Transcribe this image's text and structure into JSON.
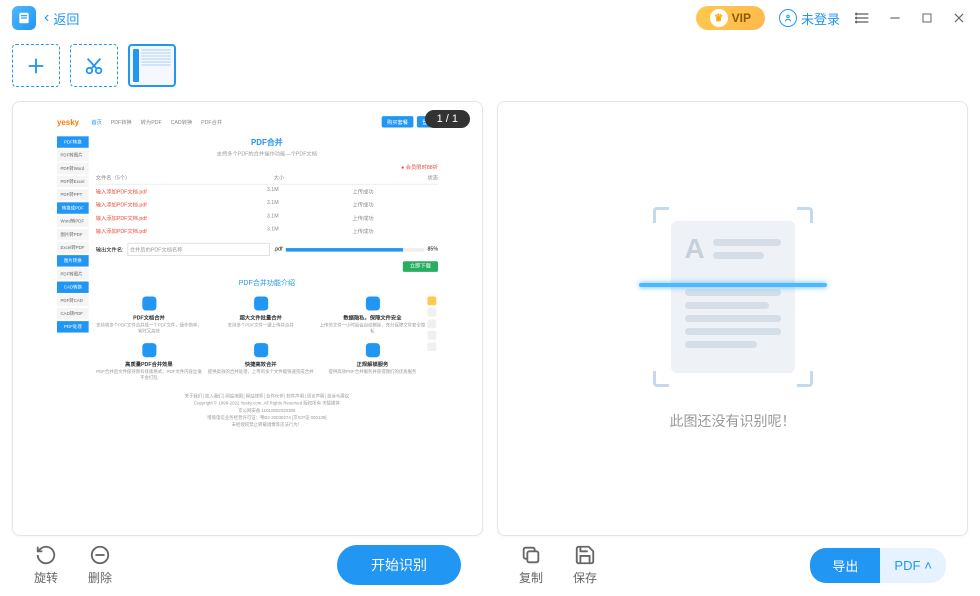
{
  "titlebar": {
    "back_label": "返回",
    "vip_label": "VIP",
    "login_label": "未登录"
  },
  "page_indicator": "1 / 1",
  "preview": {
    "logo": "yesky",
    "nav": [
      "首页",
      "PDF转换",
      "转为PDF",
      "CAD转换",
      "PDF合并"
    ],
    "header_btns": [
      "购买套餐",
      "登录"
    ],
    "title": "PDF合并",
    "subtitle": "支持多个PDF的合并操作功能—个PDF文档",
    "promo": "会员限时88折",
    "sidebar": {
      "groups": [
        {
          "title": "PDF转换",
          "items": [
            "PDF转图片",
            "PDF转Word",
            "PDF转Excel",
            "PDF转PPT"
          ]
        },
        {
          "title": "转换成PDF",
          "items": [
            "Word转PDF",
            "图片转PDF",
            "Excel转PDF"
          ]
        },
        {
          "title": "图片转换",
          "items": [
            "PDF转图片"
          ]
        },
        {
          "title": "CAD转换",
          "items": [
            "PDF转CAD",
            "CAD转PDF"
          ]
        },
        {
          "title": "PDF处理",
          "items": []
        }
      ]
    },
    "table": {
      "headers": [
        "文件名（5个）",
        "大小",
        "状态"
      ],
      "rows": [
        {
          "name": "输入添加PDF文档.pdf",
          "size": "3.1M",
          "status": "上传成功"
        },
        {
          "name": "输入添加PDF文档.pdf",
          "size": "3.1M",
          "status": "上传成功"
        },
        {
          "name": "输入添加PDF文档.pdf",
          "size": "3.1M",
          "status": "上传成功"
        },
        {
          "name": "输入添加PDF文档.pdf",
          "size": "3.1M",
          "status": "上传成功"
        }
      ]
    },
    "save_label": "输出文件名:",
    "save_value": "合并后的PDF文档名称",
    "save_ext": ".pdf",
    "progress": "85%",
    "download_btn": "立即下载",
    "features_title": "PDF合并功能介绍",
    "features": [
      {
        "title": "PDF文档合并",
        "desc": "支持将多个PDF文件合并成一个PDF文件，操作简单，省时又高效"
      },
      {
        "title": "超大文件批量合并",
        "desc": "支持多个PDF文件一键上传并合并"
      },
      {
        "title": "数据隐私，保障文件安全",
        "desc": "上传的文件一小时后会自动删除，充分保障文件安全隐私"
      },
      {
        "title": "高质量PDF合并效果",
        "desc": "PDF合并后文件保持原有排版格式，PDF文件内容丝毫不会打乱"
      },
      {
        "title": "快捷高效合并",
        "desc": "提供高效的合并处理，上传的多个文件能快速完成合并"
      },
      {
        "title": "正规解锁服务",
        "desc": "提供高效PDF合并服务并获得我们的优质服务"
      }
    ],
    "footer": {
      "links": "关于我们│加入我们│网站地图│网站律师│合作伙伴│软件声明│语言声明│投诉与建议",
      "copyright": "Copyright © 1999-2022 Yesky.com, All Rights Reserved 版权所有 天极媒体",
      "icp": "京公网安备 11010802020388",
      "license": "增值电信业务经营许可证：粤B2-20030274 [京ICP证 000139]",
      "bottom": "未经授权禁止转载镜像等违法行为！"
    }
  },
  "right_panel": {
    "empty_text": "此图还没有识别呢！"
  },
  "bottom": {
    "rotate_label": "旋转",
    "delete_label": "删除",
    "recognize_label": "开始识别",
    "copy_label": "复制",
    "save_label": "保存",
    "export_label": "导出",
    "export_format": "PDF"
  }
}
